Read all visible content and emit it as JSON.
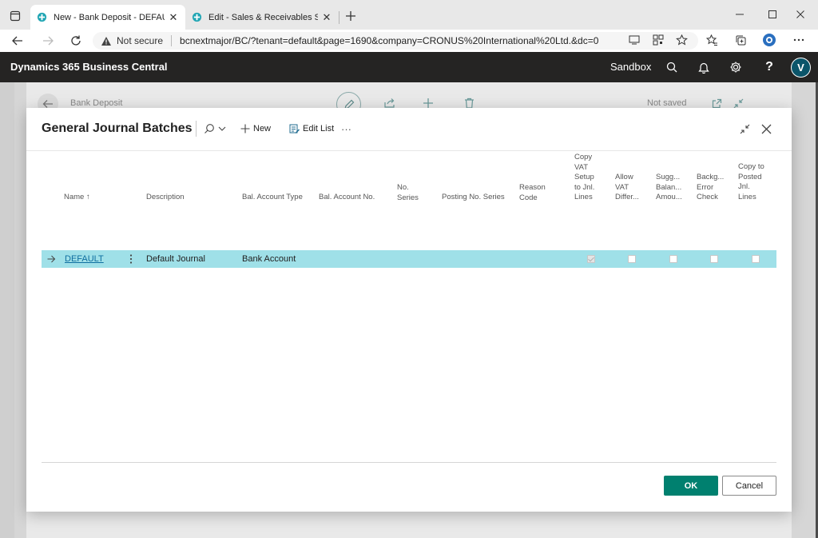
{
  "browser": {
    "tabs": [
      {
        "title": "New - Bank Deposit - DEFAULT -",
        "active": true
      },
      {
        "title": "Edit - Sales & Receivables Setup",
        "active": false
      }
    ],
    "security_label": "Not secure",
    "url": "bcnextmajor/BC/?tenant=default&page=1690&company=CRONUS%20International%20Ltd.&dc=0"
  },
  "bc_header": {
    "product": "Dynamics 365 Business Central",
    "environment": "Sandbox",
    "avatar_initial": "V",
    "colors": {
      "bar": "#252423",
      "avatar": "#0b556a"
    }
  },
  "background_page": {
    "title": "Bank Deposit",
    "status": "Not saved"
  },
  "dialog": {
    "title": "General Journal Batches",
    "actions": {
      "new_label": "New",
      "edit_list_label": "Edit List",
      "more_label": "···"
    },
    "columns": [
      {
        "key": "name",
        "label": "Name ↑"
      },
      {
        "key": "description",
        "label": "Description"
      },
      {
        "key": "bal_account_type",
        "label": "Bal. Account Type"
      },
      {
        "key": "bal_account_no",
        "label": "Bal. Account No."
      },
      {
        "key": "no_series",
        "lines": [
          "No.",
          "Series"
        ]
      },
      {
        "key": "posting_no_series",
        "label": "Posting No. Series"
      },
      {
        "key": "reason_code",
        "lines": [
          "Reason",
          "Code"
        ]
      },
      {
        "key": "copy_vat_setup",
        "lines": [
          "Copy",
          "VAT",
          "Setup",
          "to Jnl.",
          "Lines"
        ]
      },
      {
        "key": "allow_vat_diff",
        "lines": [
          "Allow",
          "VAT",
          "Differ..."
        ]
      },
      {
        "key": "suggest_balancing",
        "lines": [
          "Sugg...",
          "Balan...",
          "Amou..."
        ]
      },
      {
        "key": "background_error_check",
        "lines": [
          "Backg...",
          "Error",
          "Check"
        ]
      },
      {
        "key": "copy_to_posted",
        "lines": [
          "Copy to",
          "Posted",
          "Jnl.",
          "Lines"
        ]
      }
    ],
    "rows": [
      {
        "name": "DEFAULT",
        "description": "Default Journal",
        "bal_account_type": "Bank Account",
        "bal_account_no": "",
        "no_series": "",
        "posting_no_series": "",
        "reason_code": "",
        "copy_vat_setup": true,
        "allow_vat_diff": false,
        "suggest_balancing": false,
        "background_error_check": false,
        "copy_to_posted": false,
        "selected": true
      }
    ],
    "ok_label": "OK",
    "cancel_label": "Cancel",
    "colors": {
      "selected_row": "#9fe0e8",
      "ok_button": "#00806f",
      "link": "#0e6ea0"
    }
  }
}
